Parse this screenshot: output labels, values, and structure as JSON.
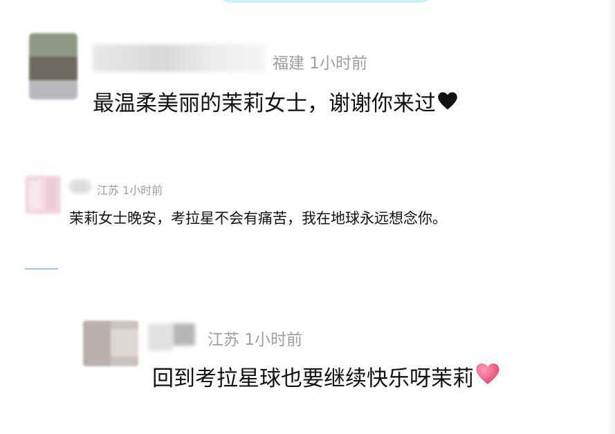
{
  "comments": [
    {
      "location": "福建",
      "time": "1小时前",
      "text": "最温柔美丽的茉莉女士，谢谢你来过",
      "heart_icon": "black-heart-icon",
      "heart_color": "#111111"
    },
    {
      "location": "江苏",
      "time": "1小时前",
      "text": "茉莉女士晚安，考拉星不会有痛苦，我在地球永远想念你。"
    },
    {
      "location": "江苏",
      "time": "1小时前",
      "text": "回到考拉星球也要继续快乐呀茉莉",
      "heart_icon": "pink-heart-icon",
      "heart_color": "#f0507a"
    }
  ],
  "colors": {
    "meta_text": "#9e9e9e",
    "body_text": "#111111",
    "accent_line": "#9cc6e6",
    "top_banner": "#cdeefb"
  }
}
